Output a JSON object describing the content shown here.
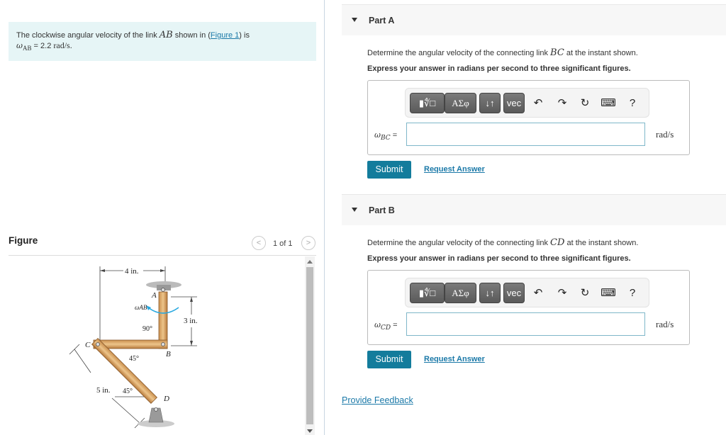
{
  "intro": {
    "text_before": "The clockwise angular velocity of the link ",
    "link_var": "AB",
    "text_mid": " shown in (",
    "figure_link": "Figure 1",
    "text_after": ") is",
    "omega_symbol": "ω",
    "omega_sub": "AB",
    "equals": " = 2.2 ",
    "unit": "rad/s."
  },
  "figure": {
    "title": "Figure",
    "pager": "1 of 1",
    "prev_icon": "chevron-left-icon",
    "next_icon": "chevron-right-icon",
    "labels": {
      "dim_top": "4 in.",
      "dim_right": "3 in.",
      "dim_diag": "5 in.",
      "point_a": "A",
      "point_b": "B",
      "point_c": "C",
      "point_d": "D",
      "omega": "ωAB",
      "angle_90": "90°",
      "angle_45_top": "45°",
      "angle_45_bottom": "45°"
    }
  },
  "parts": [
    {
      "title": "Part A",
      "prompt_before": "Determine the angular velocity of the connecting link ",
      "prompt_var": "BC",
      "prompt_after": " at the instant shown.",
      "instruction": "Express your answer in radians per second to three significant figures.",
      "answer_symbol": "ω",
      "answer_sub": "BC",
      "answer_eq": " =",
      "answer_value": "",
      "unit": "rad/s",
      "submit": "Submit",
      "request": "Request Answer"
    },
    {
      "title": "Part B",
      "prompt_before": "Determine the angular velocity of the connecting link ",
      "prompt_var": "CD",
      "prompt_after": " at the instant shown.",
      "instruction": "Express your answer in radians per second to three significant figures.",
      "answer_symbol": "ω",
      "answer_sub": "CD",
      "answer_eq": " =",
      "answer_value": "",
      "unit": "rad/s",
      "submit": "Submit",
      "request": "Request Answer"
    }
  ],
  "toolbar": {
    "templates": "▮∜□",
    "greek": "ΑΣφ",
    "arrows": "↓↑",
    "vec": "vec",
    "undo": "↶",
    "redo": "↷",
    "reset": "↻",
    "keyboard": "⌨",
    "help": "?"
  },
  "feedback": "Provide Feedback"
}
